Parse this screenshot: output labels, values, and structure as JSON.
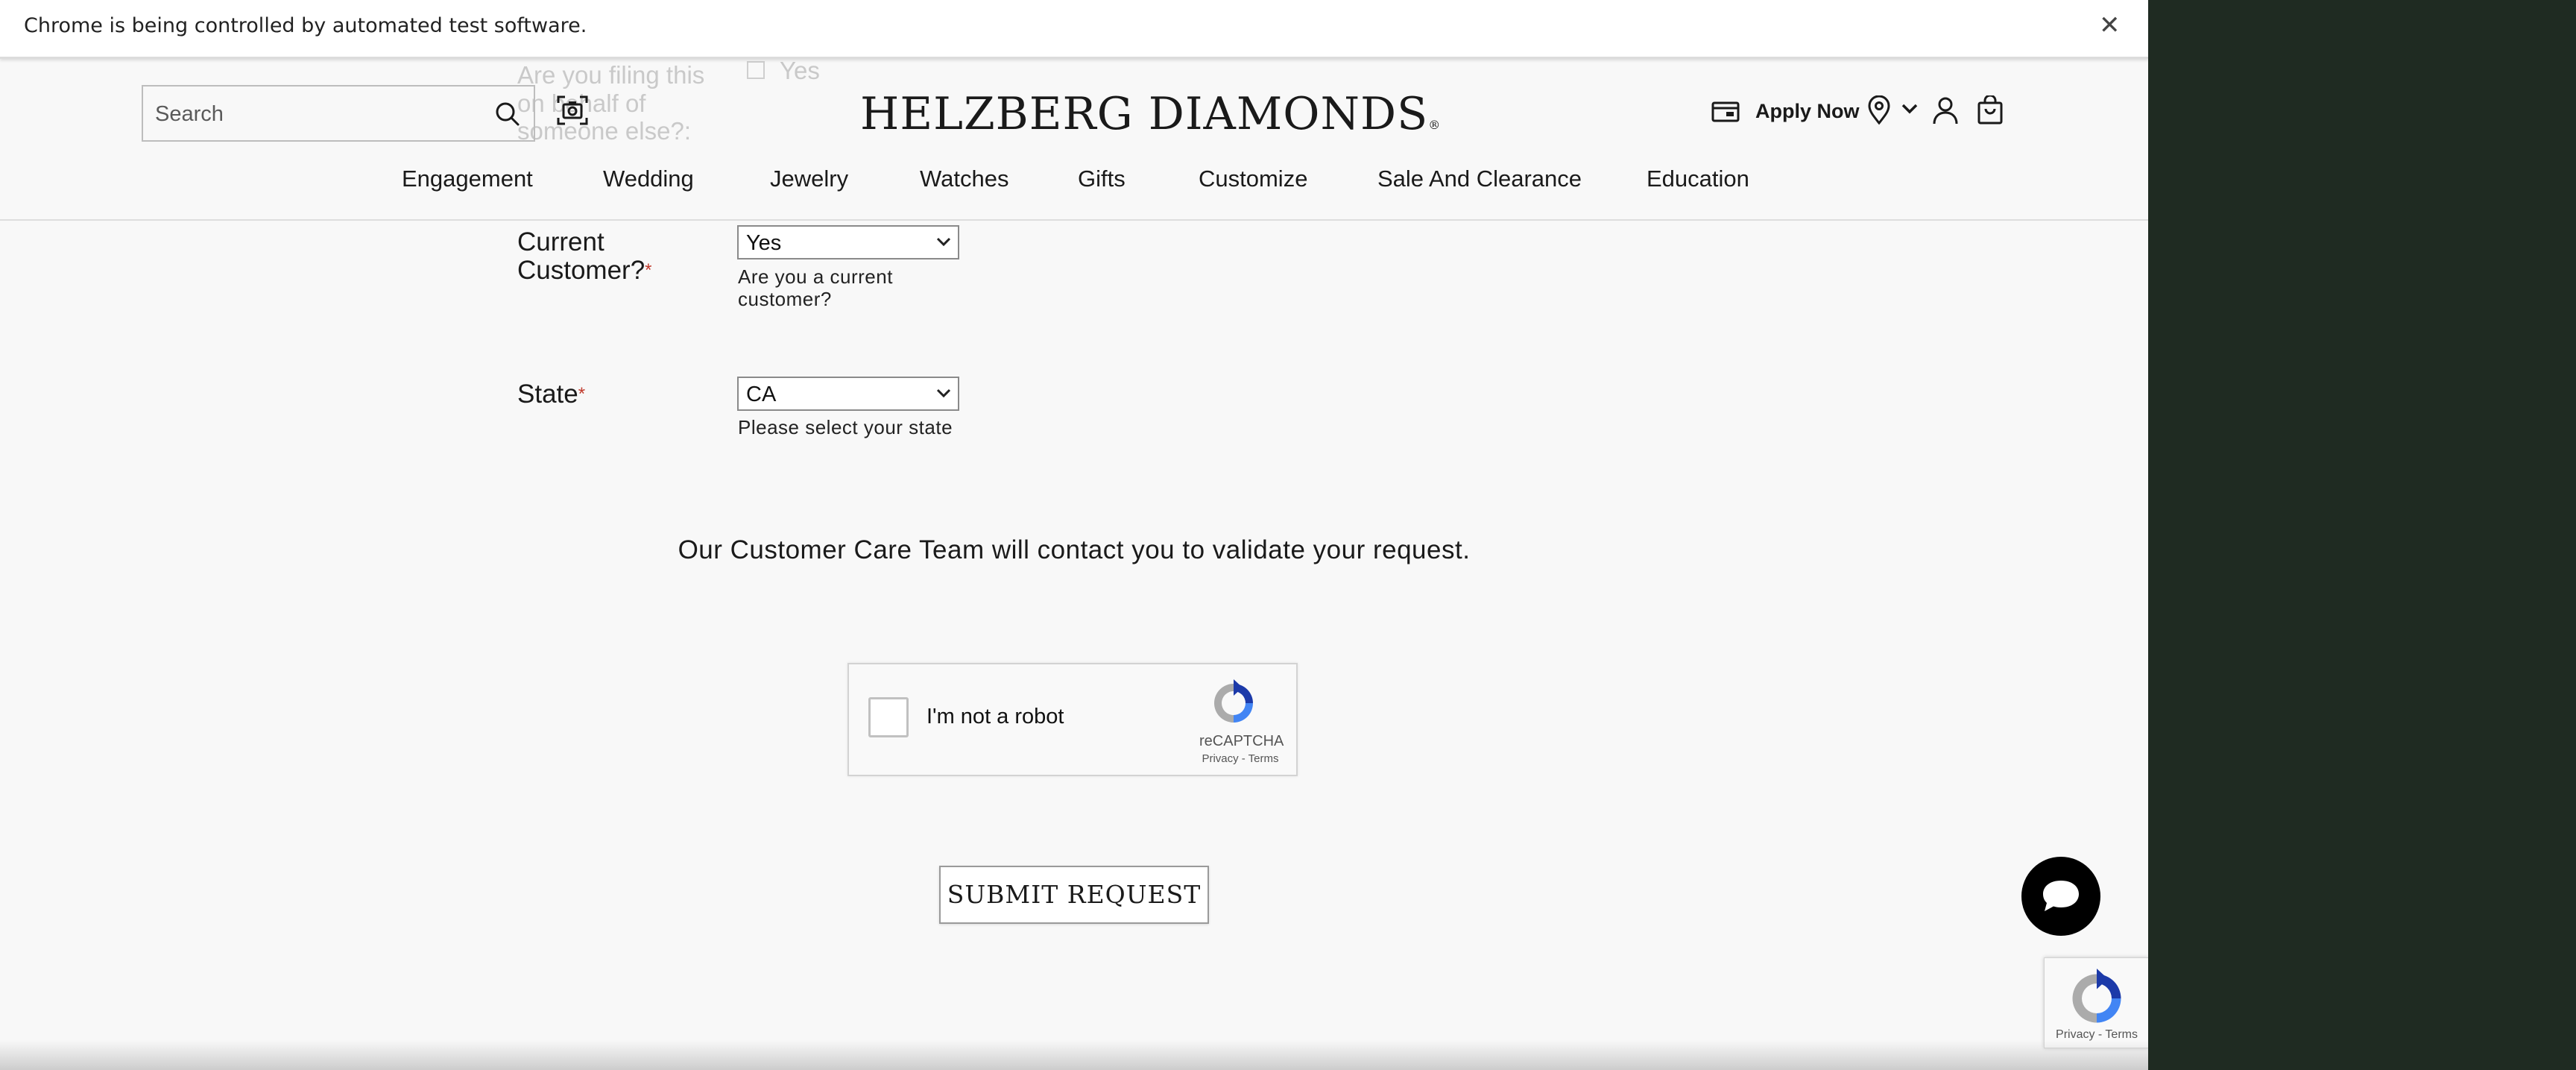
{
  "browser": {
    "automation_message": "Chrome is being controlled by automated test software.",
    "close_symbol": "✕"
  },
  "header": {
    "search": {
      "placeholder": "Search",
      "value": ""
    },
    "logo_text": "HELZBERG DIAMONDS",
    "logo_mark": "®",
    "apply_now": "Apply Now",
    "icons": [
      "search-icon",
      "camera-icon",
      "wallet-card-icon",
      "location-pin-icon",
      "chevron-down-icon",
      "account-icon",
      "cart-bag-icon"
    ]
  },
  "nav": {
    "items": [
      "Engagement",
      "Wedding",
      "Jewelry",
      "Watches",
      "Gifts",
      "Customize",
      "Sale And Clearance",
      "Education"
    ]
  },
  "form": {
    "faded_question_lines": [
      "Are you filing this",
      "on behalf of",
      "someone else?:"
    ],
    "faded_checkbox_label": "Yes",
    "current_customer": {
      "label_line1": "Current",
      "label_line2": "Customer?",
      "required_mark": "*",
      "selected": "Yes",
      "help_line1": "Are you a current",
      "help_line2": "customer?"
    },
    "state": {
      "label": "State",
      "required_mark": "*",
      "selected": "CA",
      "help": "Please select your state"
    },
    "care_message": "Our Customer Care Team will contact you to validate your request.",
    "captcha": {
      "label": "I'm not a robot",
      "brand": "reCAPTCHA",
      "links": "Privacy - Terms"
    },
    "submit_label": "SUBMIT REQUEST"
  },
  "recaptcha_badge": {
    "links": "Privacy - Terms"
  },
  "colors": {
    "required": "#c0392b",
    "page_bg": "#f8f8f8",
    "chat_button": "#000000"
  }
}
